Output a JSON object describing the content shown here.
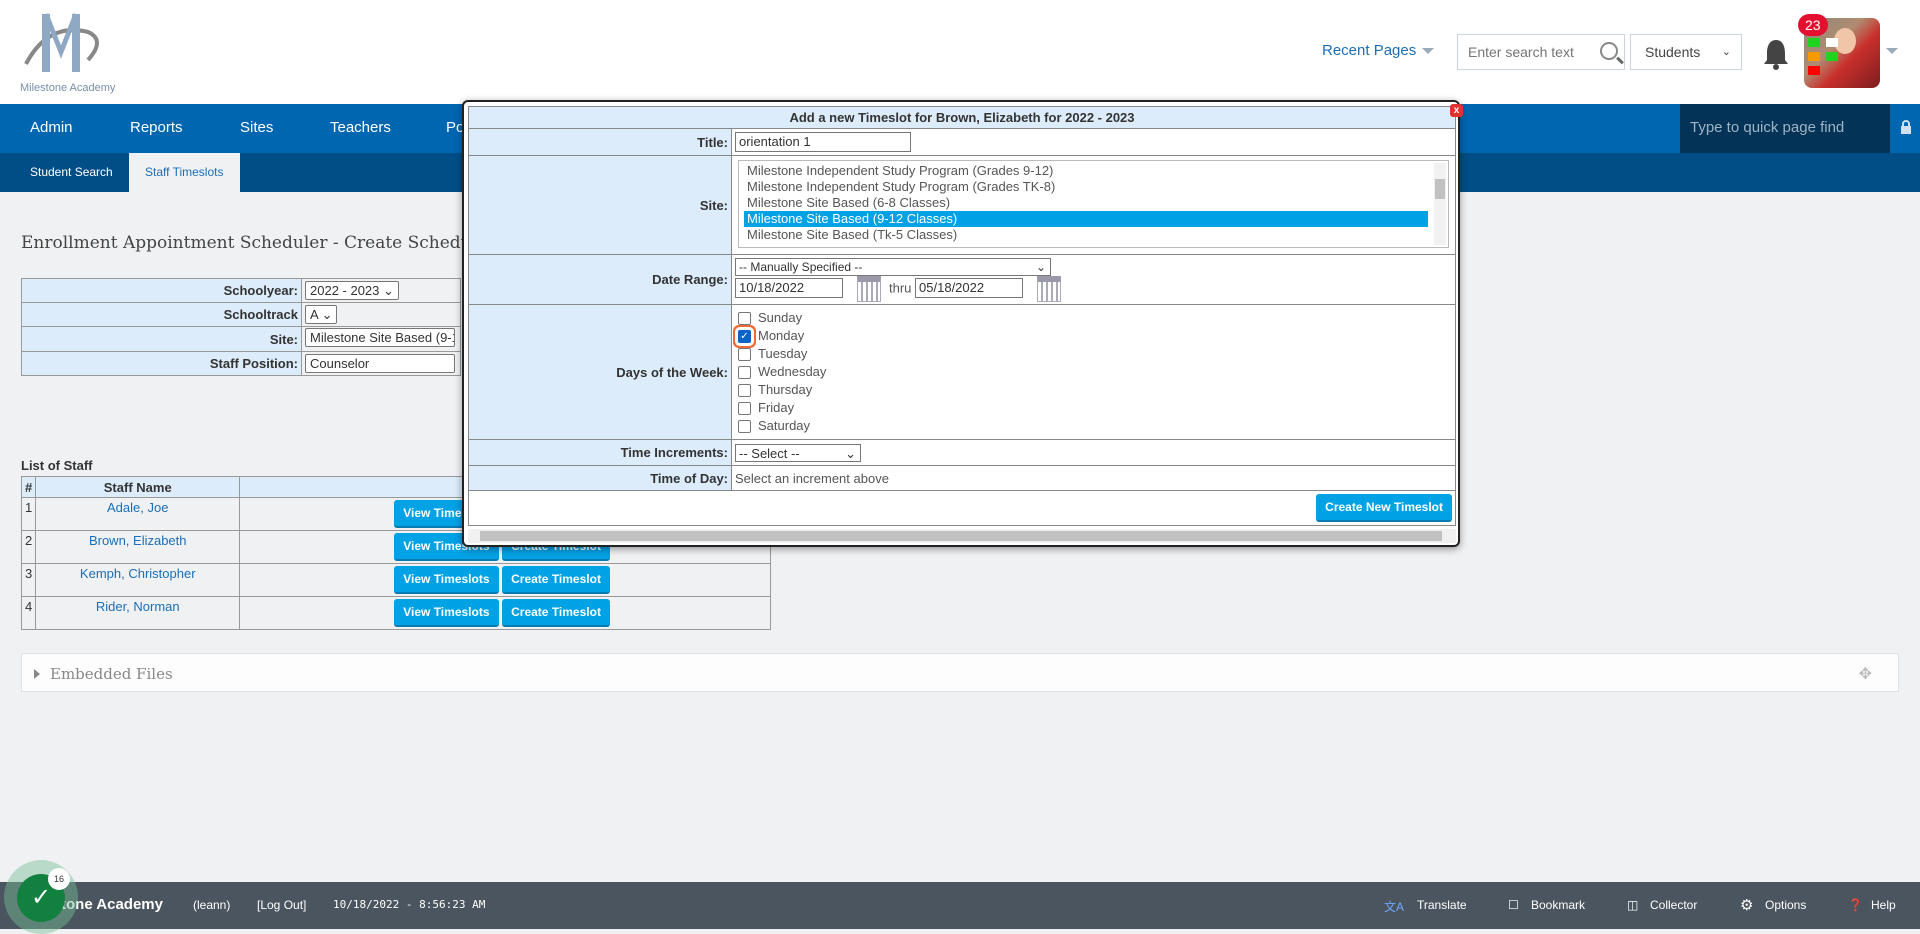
{
  "header": {
    "logo_text": "Milestone Academy",
    "recent_pages": "Recent Pages",
    "search_placeholder": "Enter search text",
    "search_type": "Students",
    "notification_count": "23"
  },
  "nav": {
    "items": [
      "Admin",
      "Reports",
      "Sites",
      "Teachers",
      "Po"
    ],
    "quick_find_placeholder": "Type to quick page find"
  },
  "subnav": {
    "items": [
      "Student Search",
      "Staff Timeslots"
    ],
    "active": "Staff Timeslots"
  },
  "page": {
    "title": "Enrollment Appointment Scheduler - Create Schedu",
    "form": {
      "schoolyear_label": "Schoolyear:",
      "schoolyear": "2022 - 2023",
      "schooltrack_label": "Schooltrack",
      "schooltrack": "A",
      "site_label": "Site:",
      "site": "Milestone Site Based (9-1",
      "position_label": "Staff Position:",
      "position": "Counselor"
    },
    "staff_list": {
      "label": "List of Staff",
      "headers": [
        "#",
        "Staff Name",
        ""
      ],
      "rows": [
        {
          "n": "1",
          "name": "Adale, Joe"
        },
        {
          "n": "2",
          "name": "Brown, Elizabeth"
        },
        {
          "n": "3",
          "name": "Kemph, Christopher"
        },
        {
          "n": "4",
          "name": "Rider, Norman"
        }
      ],
      "view_label": "View Timeslots",
      "create_label": "Create Timeslot"
    },
    "embedded_files": "Embedded Files"
  },
  "modal": {
    "title": "Add a new Timeslot for Brown, Elizabeth for 2022 - 2023",
    "close": "x",
    "title_label": "Title:",
    "title_value": "orientation 1",
    "site_label": "Site:",
    "site_options": [
      "Milestone Independent Study Program (Grades 9-12)",
      "Milestone Independent Study Program (Grades TK-8)",
      "Milestone Site Based (6-8 Classes)",
      "Milestone Site Based (9-12 Classes)",
      "Milestone Site Based (Tk-5 Classes)"
    ],
    "site_selected": "Milestone Site Based (9-12 Classes)",
    "date_range_label": "Date Range:",
    "date_range_mode": "-- Manually Specified --",
    "date_from": "10/18/2022",
    "thru": "thru",
    "date_to": "05/18/2022",
    "days_label": "Days of the Week:",
    "days": [
      {
        "name": "Sunday",
        "checked": false
      },
      {
        "name": "Monday",
        "checked": true
      },
      {
        "name": "Tuesday",
        "checked": false
      },
      {
        "name": "Wednesday",
        "checked": false
      },
      {
        "name": "Thursday",
        "checked": false
      },
      {
        "name": "Friday",
        "checked": false
      },
      {
        "name": "Saturday",
        "checked": false
      }
    ],
    "time_inc_label": "Time Increments:",
    "time_inc": "-- Select --",
    "time_of_day_label": "Time of Day:",
    "time_of_day": "Select an increment above",
    "submit": "Create New Timeslot"
  },
  "footer": {
    "school": "tone Academy",
    "user": "(leann)",
    "logout": "[Log Out]",
    "datetime": "10/18/2022 - 8:56:23 AM",
    "actions": [
      "Translate",
      "Bookmark",
      "Collector",
      "Options",
      "Help"
    ],
    "task_count": "16"
  },
  "colors": {
    "nav": "#0066b0",
    "subnav": "#004e85",
    "button": "#00a2e6",
    "label_bg": "#dcecfb",
    "footer": "#4a5560"
  }
}
